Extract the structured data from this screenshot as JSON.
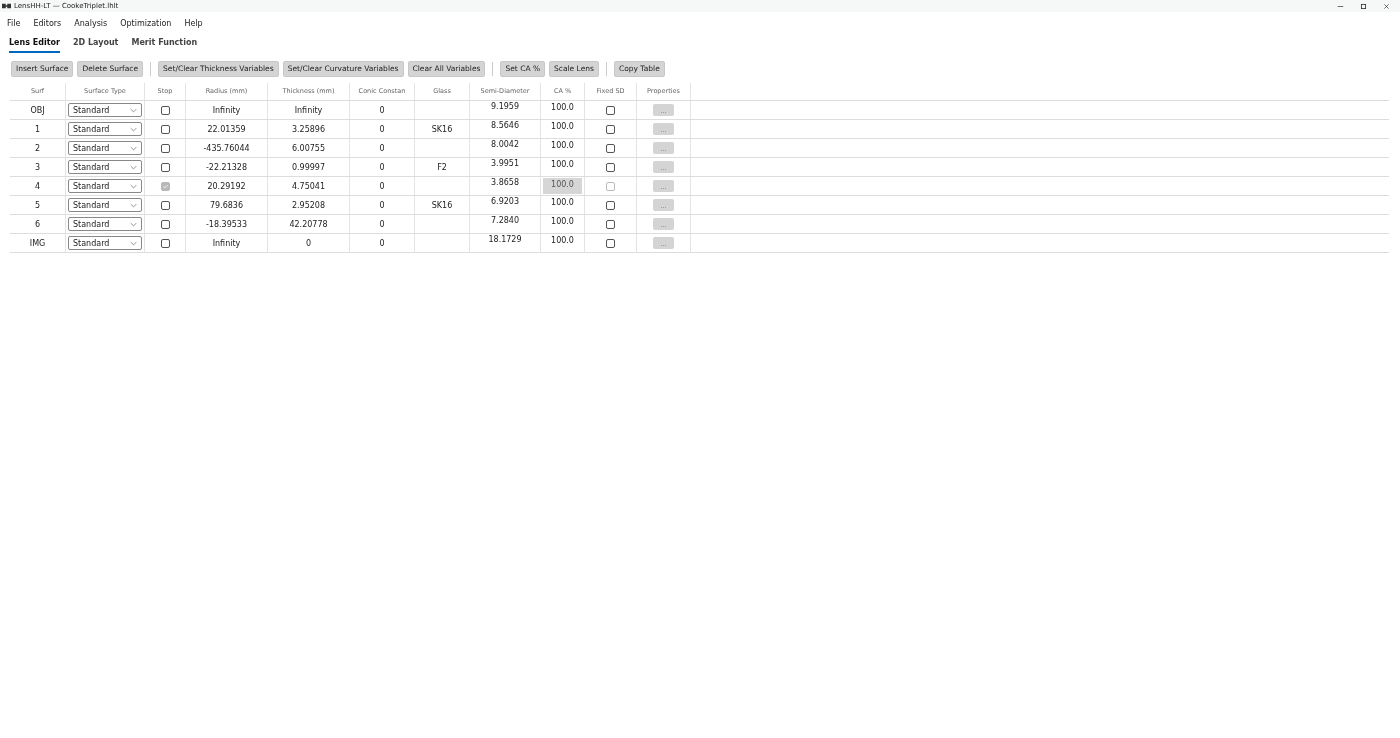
{
  "window": {
    "title": "LensHH-LT — CookeTriplet.lhlt"
  },
  "menu": [
    "File",
    "Editors",
    "Analysis",
    "Optimization",
    "Help"
  ],
  "tabs": [
    {
      "label": "Lens Editor",
      "selected": true
    },
    {
      "label": "2D Layout",
      "selected": false
    },
    {
      "label": "Merit Function",
      "selected": false
    }
  ],
  "toolbar": [
    [
      "Insert Surface",
      "Delete Surface"
    ],
    [
      "Set/Clear Thickness Variables",
      "Set/Clear Curvature Variables",
      "Clear All Variables"
    ],
    [
      "Set CA %",
      "Scale Lens"
    ],
    [
      "Copy Table"
    ]
  ],
  "table": {
    "columns": [
      "Surf",
      "Surface Type",
      "Stop",
      "Radius (mm)",
      "Thickness (mm)",
      "Conic Constan",
      "Glass",
      "Semi-Diameter",
      "CA %",
      "Fixed SD",
      "Properties"
    ],
    "rows": [
      {
        "surf": "OBJ",
        "type": "Standard",
        "stop": false,
        "radius": "Infinity",
        "thickness": "Infinity",
        "conic": "0",
        "glass": "",
        "semi": "9.1959",
        "ca": "100.0",
        "ca_disabled": false,
        "fixed_sd": false,
        "fixed_sd_disabled": false,
        "props": "..."
      },
      {
        "surf": "1",
        "type": "Standard",
        "stop": false,
        "radius": "22.01359",
        "thickness": "3.25896",
        "conic": "0",
        "glass": "SK16",
        "semi": "8.5646",
        "ca": "100.0",
        "ca_disabled": false,
        "fixed_sd": false,
        "fixed_sd_disabled": false,
        "props": "..."
      },
      {
        "surf": "2",
        "type": "Standard",
        "stop": false,
        "radius": "-435.76044",
        "thickness": "6.00755",
        "conic": "0",
        "glass": "",
        "semi": "8.0042",
        "ca": "100.0",
        "ca_disabled": false,
        "fixed_sd": false,
        "fixed_sd_disabled": false,
        "props": "..."
      },
      {
        "surf": "3",
        "type": "Standard",
        "stop": false,
        "radius": "-22.21328",
        "thickness": "0.99997",
        "conic": "0",
        "glass": "F2",
        "semi": "3.9951",
        "ca": "100.0",
        "ca_disabled": false,
        "fixed_sd": false,
        "fixed_sd_disabled": false,
        "props": "..."
      },
      {
        "surf": "4",
        "type": "Standard",
        "stop": true,
        "radius": "20.29192",
        "thickness": "4.75041",
        "conic": "0",
        "glass": "",
        "semi": "3.8658",
        "ca": "100.0",
        "ca_disabled": true,
        "fixed_sd": false,
        "fixed_sd_disabled": true,
        "props": "..."
      },
      {
        "surf": "5",
        "type": "Standard",
        "stop": false,
        "radius": "79.6836",
        "thickness": "2.95208",
        "conic": "0",
        "glass": "SK16",
        "semi": "6.9203",
        "ca": "100.0",
        "ca_disabled": false,
        "fixed_sd": false,
        "fixed_sd_disabled": false,
        "props": "..."
      },
      {
        "surf": "6",
        "type": "Standard",
        "stop": false,
        "radius": "-18.39533",
        "thickness": "42.20778",
        "conic": "0",
        "glass": "",
        "semi": "7.2840",
        "ca": "100.0",
        "ca_disabled": false,
        "fixed_sd": false,
        "fixed_sd_disabled": false,
        "props": "..."
      },
      {
        "surf": "IMG",
        "type": "Standard",
        "stop": false,
        "radius": "Infinity",
        "thickness": "0",
        "conic": "0",
        "glass": "",
        "semi": "18.1729",
        "ca": "100.0",
        "ca_disabled": false,
        "fixed_sd": false,
        "fixed_sd_disabled": false,
        "props": "..."
      }
    ]
  }
}
